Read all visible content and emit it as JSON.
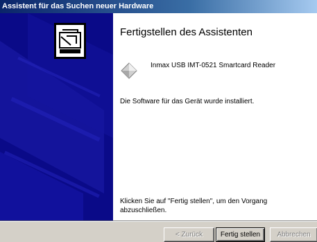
{
  "window": {
    "title": "Assistent für das Suchen neuer Hardware"
  },
  "main": {
    "heading": "Fertigstellen des Assistenten",
    "device_name": "Inmax USB IMT-0521 Smartcard Reader",
    "installed_text": "Die Software für das Gerät wurde installiert.",
    "finish_hint": "Klicken Sie auf \"Fertig stellen\", um den Vorgang abzuschließen."
  },
  "buttons": {
    "back_label": "< Zurück",
    "finish_label": "Fertig stellen",
    "cancel_label": "Abbrechen"
  },
  "icons": {
    "wizard": "hardware-wizard-icon",
    "device": "device-diamond-icon"
  },
  "colors": {
    "sidebar_bg": "#0a0a88",
    "titlebar_start": "#0a246a",
    "content_bg": "#ffffff",
    "button_face": "#d4d0c8"
  }
}
